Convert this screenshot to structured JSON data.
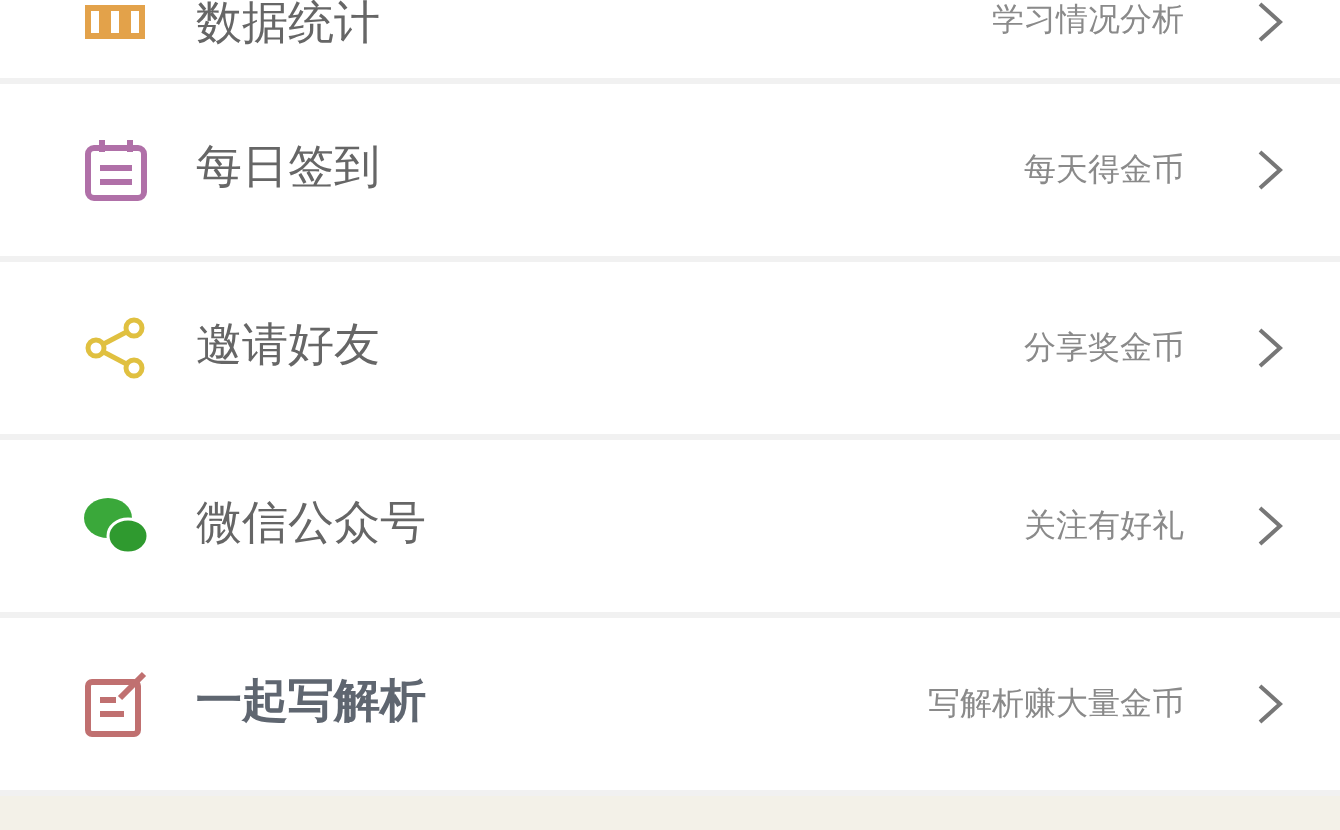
{
  "menu": [
    {
      "title": "数据统计",
      "hint": "学习情况分析",
      "emphasized": false
    },
    {
      "title": "每日签到",
      "hint": "每天得金币",
      "emphasized": false
    },
    {
      "title": "邀请好友",
      "hint": "分享奖金币",
      "emphasized": false
    },
    {
      "title": "微信公众号",
      "hint": "关注有好礼",
      "emphasized": false
    },
    {
      "title": "一起写解析",
      "hint": "写解析赚大量金币",
      "emphasized": true
    }
  ]
}
